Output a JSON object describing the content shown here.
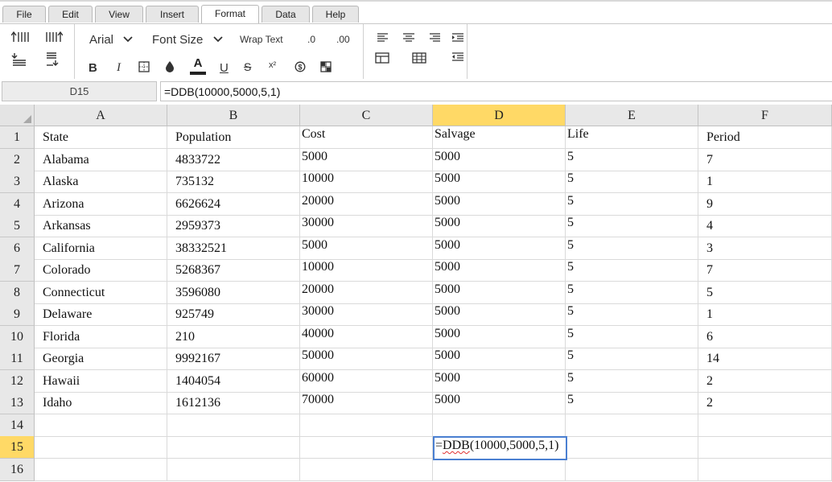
{
  "menu": {
    "tabs": [
      "File",
      "Edit",
      "View",
      "Insert",
      "Format",
      "Data",
      "Help"
    ],
    "active": "Format"
  },
  "toolbar": {
    "font_name": "Arial",
    "font_size_label": "Font Size",
    "wrap_text_label": "Wrap Text",
    "decrease_decimal_label": ".0",
    "increase_decimal_label": ".00",
    "bold_label": "B",
    "italic_label": "I",
    "strike_label": "S",
    "superscript_label": "x²",
    "underline_label": "U",
    "font_color_label": "A",
    "icons": [
      "insert-row-above-icon",
      "insert-row-below-icon",
      "insert-col-left-icon",
      "insert-col-right-icon",
      "chevron-down-icon",
      "borders-icon",
      "fill-color-icon",
      "font-color-icon",
      "currency-icon",
      "merge-icon",
      "align-left-icon",
      "align-center-icon",
      "align-right-icon",
      "indent-icon",
      "outdent-icon",
      "table-icon",
      "grid-icon"
    ]
  },
  "formula_bar": {
    "cell_ref": "D15",
    "formula": "=DDB(10000,5000,5,1)"
  },
  "sheet": {
    "columns": [
      "A",
      "B",
      "C",
      "D",
      "E",
      "F"
    ],
    "selected_column": "D",
    "selected_row": "15",
    "rows": [
      {
        "n": "1",
        "cells": [
          "State",
          "Population",
          "Cost",
          "Salvage",
          "Life",
          "Period"
        ]
      },
      {
        "n": "2",
        "cells": [
          "Alabama",
          "4833722",
          "5000",
          "5000",
          "5",
          "7"
        ]
      },
      {
        "n": "3",
        "cells": [
          "Alaska",
          "735132",
          "10000",
          "5000",
          "5",
          "1"
        ]
      },
      {
        "n": "4",
        "cells": [
          "Arizona",
          "6626624",
          "20000",
          "5000",
          "5",
          "9"
        ]
      },
      {
        "n": "5",
        "cells": [
          "Arkansas",
          "2959373",
          "30000",
          "5000",
          "5",
          "4"
        ]
      },
      {
        "n": "6",
        "cells": [
          "California",
          "38332521",
          "5000",
          "5000",
          "5",
          "3"
        ]
      },
      {
        "n": "7",
        "cells": [
          "Colorado",
          "5268367",
          "10000",
          "5000",
          "5",
          "7"
        ]
      },
      {
        "n": "8",
        "cells": [
          "Connecticut",
          "3596080",
          "20000",
          "5000",
          "5",
          "5"
        ]
      },
      {
        "n": "9",
        "cells": [
          "Delaware",
          "925749",
          "30000",
          "5000",
          "5",
          "1"
        ]
      },
      {
        "n": "10",
        "cells": [
          "Florida",
          "210",
          "40000",
          "5000",
          "5",
          "6"
        ]
      },
      {
        "n": "11",
        "cells": [
          "Georgia",
          "9992167",
          "50000",
          "5000",
          "5",
          "14"
        ]
      },
      {
        "n": "12",
        "cells": [
          "Hawaii",
          "1404054",
          "60000",
          "5000",
          "5",
          "2"
        ]
      },
      {
        "n": "13",
        "cells": [
          "Idaho",
          "1612136",
          "70000",
          "5000",
          "5",
          "2"
        ]
      },
      {
        "n": "14",
        "cells": [
          "",
          "",
          "",
          "",
          "",
          ""
        ]
      },
      {
        "n": "15",
        "cells": [
          "",
          "",
          "",
          "",
          "",
          ""
        ]
      },
      {
        "n": "16",
        "cells": [
          "",
          "",
          "",
          "",
          "",
          ""
        ]
      }
    ],
    "editing": {
      "prefix": "=",
      "func": "DDB",
      "rest": "(10000,5000,5,1)"
    }
  },
  "colors": {
    "selected_header": "#ffd966",
    "active_border": "#4a7fd1",
    "header_bg": "#e8e8e8"
  }
}
